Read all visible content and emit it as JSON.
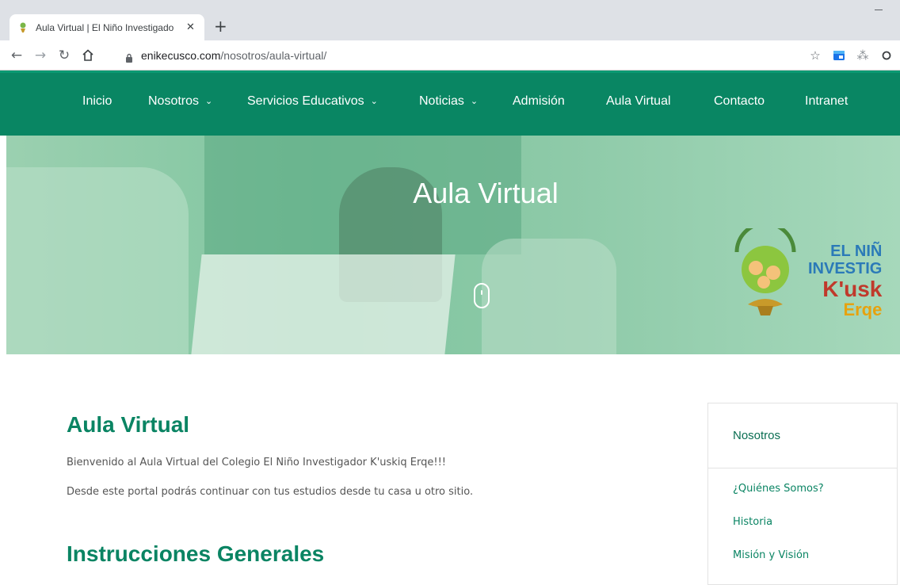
{
  "browser": {
    "tab_title": "Aula Virtual | El Niño Investigado",
    "tab_close": "✕",
    "new_tab": "+",
    "url_host": "enikecusco.com",
    "url_path": "/nosotros/aula-virtual/"
  },
  "nav": {
    "items": [
      {
        "label": "Inicio",
        "has_dropdown": false
      },
      {
        "label": "Nosotros",
        "has_dropdown": true
      },
      {
        "label": "Servicios Educativos",
        "has_dropdown": true
      },
      {
        "label": "Noticias",
        "has_dropdown": true
      },
      {
        "label": "Admisión",
        "has_dropdown": false
      },
      {
        "label": "Aula Virtual",
        "has_dropdown": false
      },
      {
        "label": "Contacto",
        "has_dropdown": false
      },
      {
        "label": "Intranet",
        "has_dropdown": false
      }
    ],
    "chevron": "⌄",
    "background": "#098663"
  },
  "hero": {
    "title": "Aula Virtual",
    "logo_lines": [
      "EL NIÑ",
      "INVESTIG",
      "K'usk",
      "Erqe"
    ]
  },
  "main": {
    "heading": "Aula Virtual",
    "paragraphs": [
      "Bienvenido al Aula Virtual del Colegio El Niño Investigador K'uskiq Erqe!!!",
      "Desde este portal podrás continuar con tus estudios desde tu casa u otro sitio."
    ],
    "subheading": "Instrucciones Generales"
  },
  "sidebar": {
    "heading": "Nosotros",
    "links": [
      "¿Quiénes Somos?",
      "Historia",
      "Misión y Visión"
    ]
  },
  "colors": {
    "brand_green": "#098663",
    "heading_green": "#0a8463"
  }
}
